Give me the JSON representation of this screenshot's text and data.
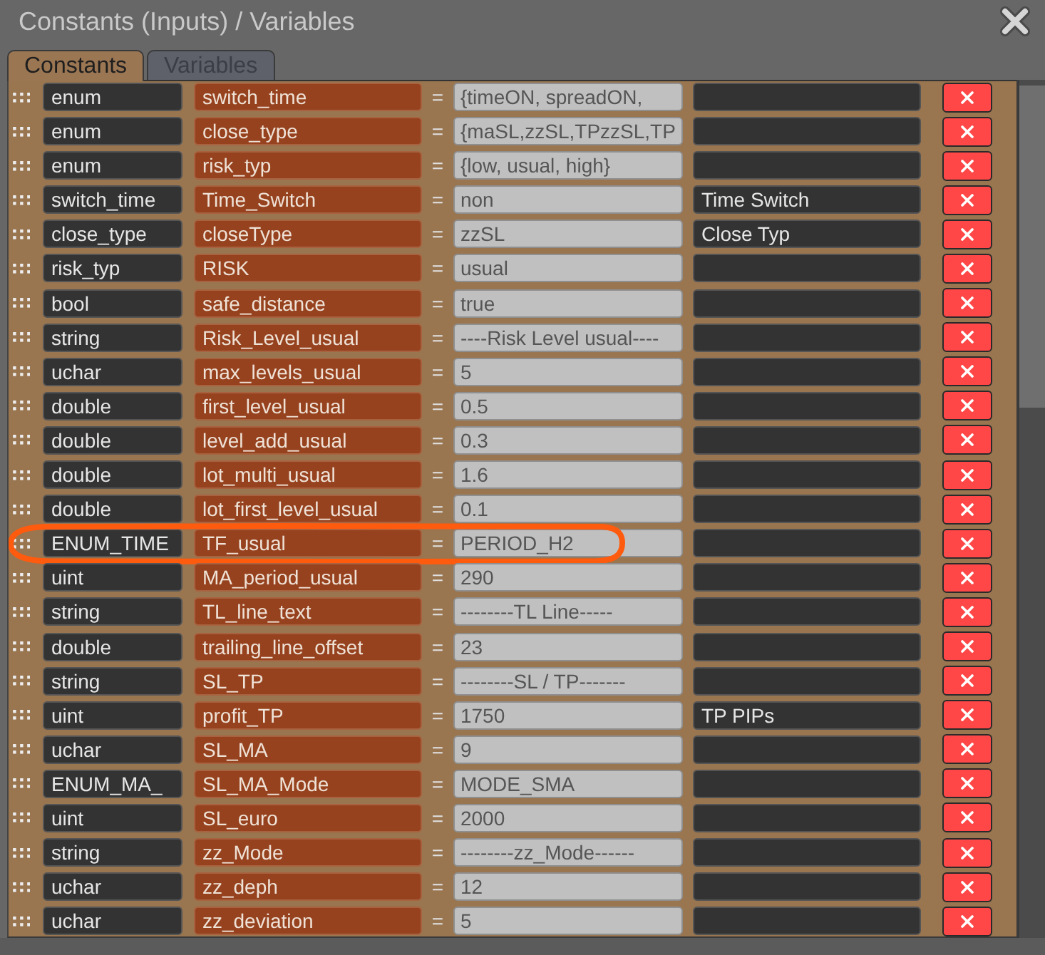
{
  "window": {
    "title": "Constants (Inputs) / Variables"
  },
  "tabs": [
    {
      "label": "Constants",
      "selected": true
    },
    {
      "label": "Variables",
      "selected": false
    }
  ],
  "rows": [
    {
      "type": "enum",
      "name": "switch_time",
      "operator": "=",
      "value": "{timeON, spreadON,",
      "circled": false
    },
    {
      "type": "enum",
      "name": "close_type",
      "operator": "=",
      "value": "{maSL,zzSL,TPzzSL,TP",
      "circled": false
    },
    {
      "type": "enum",
      "name": "risk_typ",
      "operator": "=",
      "value": "{low, usual, high}",
      "circled": false
    },
    {
      "type": "switch_time",
      "name": "Time_Switch",
      "operator": "=",
      "value": "non",
      "comment": "Time Switch",
      "circled": false
    },
    {
      "type": "close_type",
      "name": "closeType",
      "operator": "=",
      "value": "zzSL",
      "comment": "Close Typ",
      "circled": false
    },
    {
      "type": "risk_typ",
      "name": "RISK",
      "operator": "=",
      "value": "usual",
      "circled": false
    },
    {
      "type": "bool",
      "name": "safe_distance",
      "operator": "=",
      "value": "true",
      "circled": false
    },
    {
      "type": "string",
      "name": "Risk_Level_usual",
      "operator": "=",
      "value": "----Risk Level usual----",
      "circled": false
    },
    {
      "type": "uchar",
      "name": "max_levels_usual",
      "operator": "=",
      "value": "5",
      "circled": false
    },
    {
      "type": "double",
      "name": "first_level_usual",
      "operator": "=",
      "value": "0.5",
      "circled": false
    },
    {
      "type": "double",
      "name": "level_add_usual",
      "operator": "=",
      "value": "0.3",
      "circled": false
    },
    {
      "type": "double",
      "name": "lot_multi_usual",
      "operator": "=",
      "value": "1.6",
      "circled": false
    },
    {
      "type": "double",
      "name": "lot_first_level_usual",
      "operator": "=",
      "value": "0.1",
      "circled": false
    },
    {
      "type": "ENUM_TIME",
      "name": "TF_usual",
      "operator": "=",
      "value": "PERIOD_H2",
      "circled": true
    },
    {
      "type": "uint",
      "name": "MA_period_usual",
      "operator": "=",
      "value": "290",
      "circled": false
    },
    {
      "type": "string",
      "name": "TL_line_text",
      "operator": "=",
      "value": "--------TL Line-----",
      "circled": false
    },
    {
      "type": "double",
      "name": "trailing_line_offset",
      "operator": "=",
      "value": "23",
      "circled": false
    },
    {
      "type": "string",
      "name": "SL_TP",
      "operator": "=",
      "value": "--------SL / TP-------",
      "circled": false
    },
    {
      "type": "uint",
      "name": "profit_TP",
      "operator": "=",
      "value": "1750",
      "comment": "TP PIPs",
      "circled": false
    },
    {
      "type": "uchar",
      "name": "SL_MA",
      "operator": "=",
      "value": "9",
      "circled": false
    },
    {
      "type": "ENUM_MA_",
      "name": "SL_MA_Mode",
      "operator": "=",
      "value": "MODE_SMA",
      "circled": false
    },
    {
      "type": "uint",
      "name": "SL_euro",
      "operator": "=",
      "value": "2000",
      "circled": false
    },
    {
      "type": "string",
      "name": "zz_Mode",
      "operator": "=",
      "value": "--------zz_Mode------",
      "circled": false
    },
    {
      "type": "uchar",
      "name": "zz_deph",
      "operator": "=",
      "value": "12",
      "circled": false
    },
    {
      "type": "uchar",
      "name": "zz_deviation",
      "operator": "=",
      "value": "5",
      "circled": false
    }
  ]
}
